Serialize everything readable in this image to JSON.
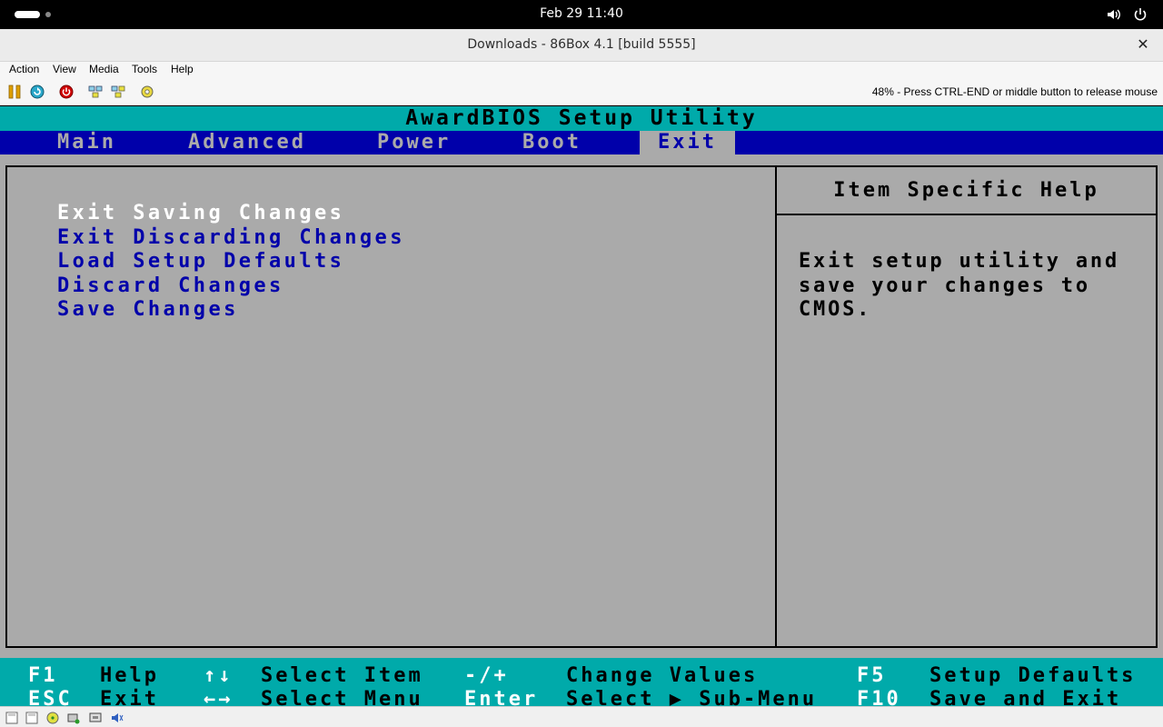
{
  "system": {
    "clock": "Feb 29  11:40",
    "icons": [
      "activities-pill",
      "workspace-dot",
      "volume-icon",
      "power-icon"
    ]
  },
  "window": {
    "title": "Downloads - 86Box 4.1 [build 5555]",
    "close_glyph": "✕"
  },
  "menubar": {
    "items": [
      "Action",
      "View",
      "Media",
      "Tools",
      "Help"
    ]
  },
  "toolbar": {
    "buttons": [
      "pause-icon",
      "reset-icon",
      "power-off-icon",
      "ctrl-alt-del-icon",
      "ctrl-alt-esc-icon",
      "settings-icon"
    ],
    "status": "48% - Press CTRL-END or middle button to release mouse"
  },
  "bios": {
    "title": "AwardBIOS Setup Utility",
    "tabs": [
      "Main",
      "Advanced",
      "Power",
      "Boot",
      "Exit"
    ],
    "active_tab": "Exit",
    "menu": [
      "Exit Saving Changes",
      "Exit Discarding Changes",
      "Load Setup Defaults",
      "Discard Changes",
      "Save Changes"
    ],
    "selected_item": "Exit Saving Changes",
    "help": {
      "title": "Item Specific Help",
      "lines": [
        "Exit setup utility and",
        "save your changes to",
        "CMOS."
      ]
    },
    "footer": {
      "row1": {
        "k1": "F1",
        "d1": "Help",
        "k2": "↑↓",
        "d2": "Select Item",
        "k3": "-/+",
        "d3": "Change Values",
        "k4": "F5",
        "d4": "Setup Defaults"
      },
      "row2": {
        "k1": "ESC",
        "d1": "Exit",
        "k2": "←→",
        "d2": "Select Menu",
        "k3": "Enter",
        "d3": "Select ▶ Sub-Menu",
        "k4": "F10",
        "d4": "Save and Exit"
      }
    },
    "colors": {
      "bg": "#aaaaaa",
      "cyan": "#00aaaa",
      "blue": "#0000aa",
      "white": "#ffffff"
    }
  },
  "statusbar": {
    "icons": [
      "floppy-a-icon",
      "floppy-b-icon",
      "cdrom-icon",
      "hdd-icon",
      "network-icon",
      "sound-icon"
    ]
  }
}
